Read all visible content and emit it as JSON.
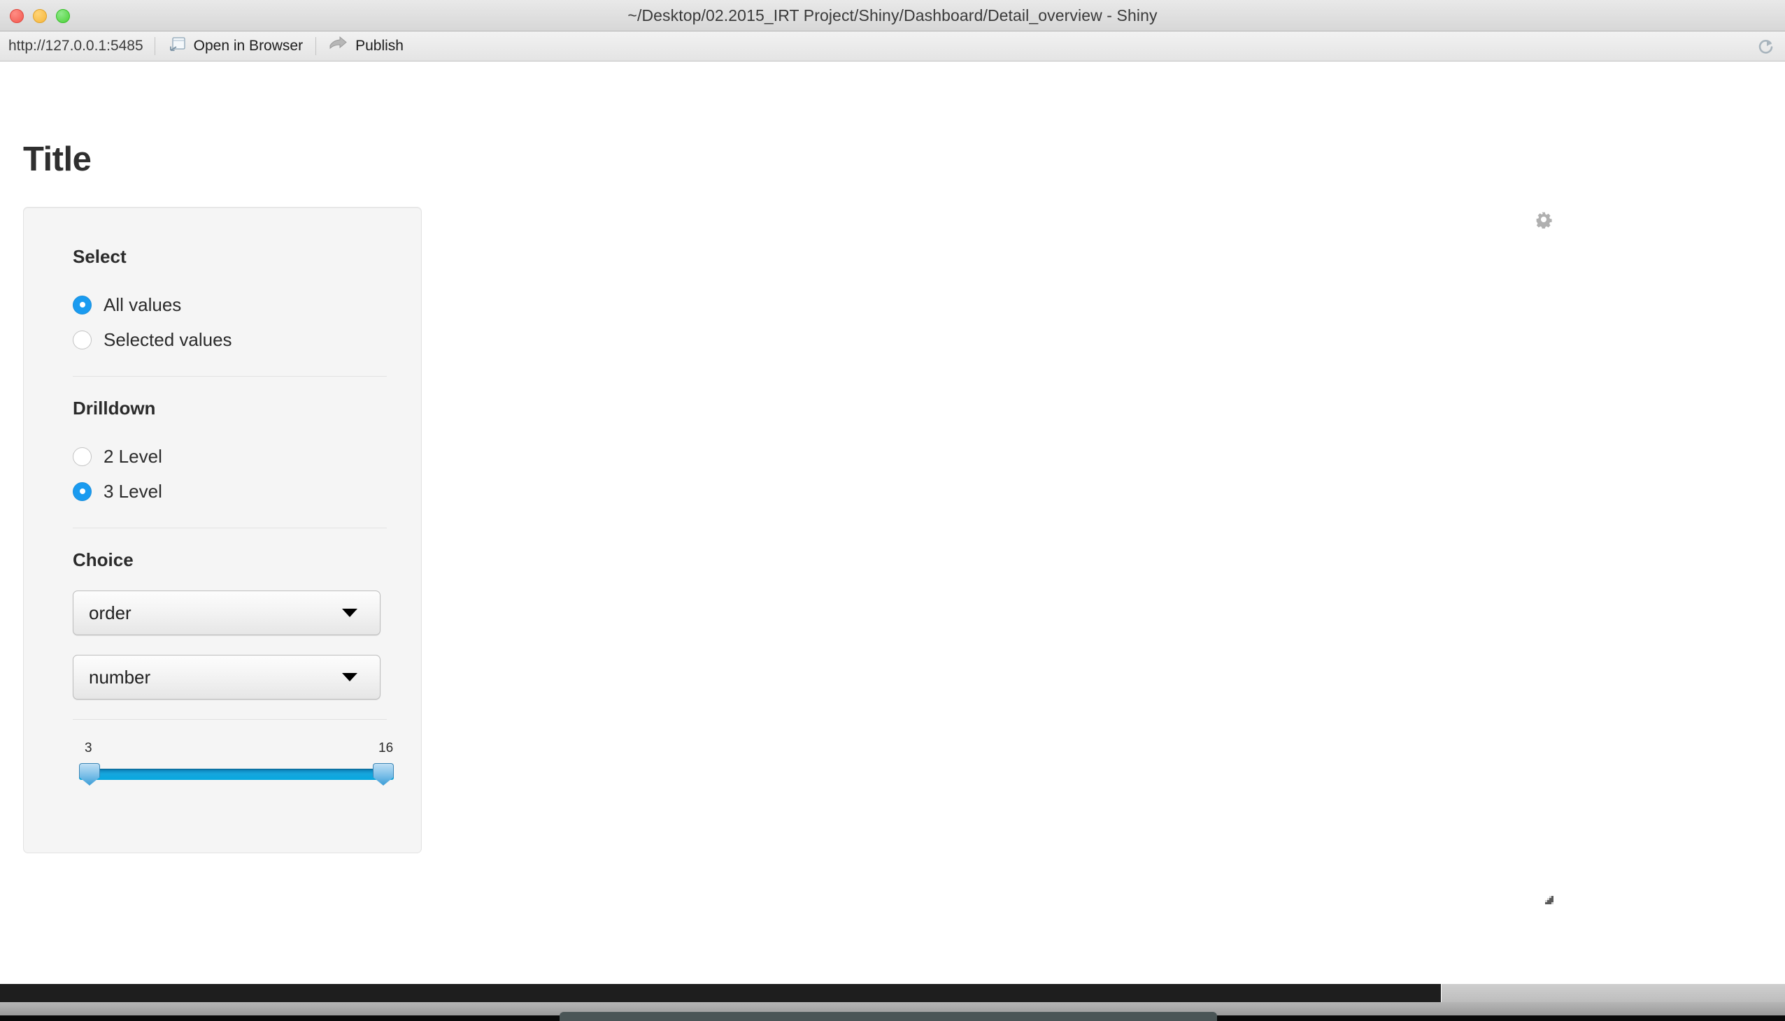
{
  "window": {
    "title": "~/Desktop/02.2015_IRT Project/Shiny/Dashboard/Detail_overview - Shiny",
    "traffic_lights": {
      "close_label": "close",
      "minimize_label": "minimize",
      "maximize_label": "maximize"
    }
  },
  "toolbar": {
    "url": "http://127.0.0.1:5485",
    "open_in_browser_label": "Open in Browser",
    "publish_label": "Publish",
    "open_in_browser_icon": "window-arrow-icon",
    "publish_icon": "arrow-right-icon",
    "refresh_icon": "refresh-icon"
  },
  "app": {
    "page_title": "Title",
    "sidebar": {
      "select": {
        "heading": "Select",
        "options": [
          {
            "label": "All values",
            "checked": true
          },
          {
            "label": "Selected values",
            "checked": false
          }
        ]
      },
      "drilldown": {
        "heading": "Drilldown",
        "options": [
          {
            "label": "2 Level",
            "checked": false
          },
          {
            "label": "3 Level",
            "checked": true
          }
        ]
      },
      "choice": {
        "heading": "Choice",
        "selects": [
          {
            "name": "order-select",
            "value": "order"
          },
          {
            "name": "number-select",
            "value": "number"
          }
        ]
      },
      "slider": {
        "min_label": "3",
        "max_label": "16",
        "min_value": 3,
        "max_value": 16
      }
    },
    "main": {
      "gear_icon": "gear-icon",
      "resize_grip_icon": "resize-grip-icon"
    }
  },
  "colors": {
    "accent": "#1a9bf0",
    "slider_track": "#16a6dd",
    "panel_bg": "#f5f5f5",
    "panel_border": "#e3e3e3",
    "text": "#2b2b2b"
  }
}
